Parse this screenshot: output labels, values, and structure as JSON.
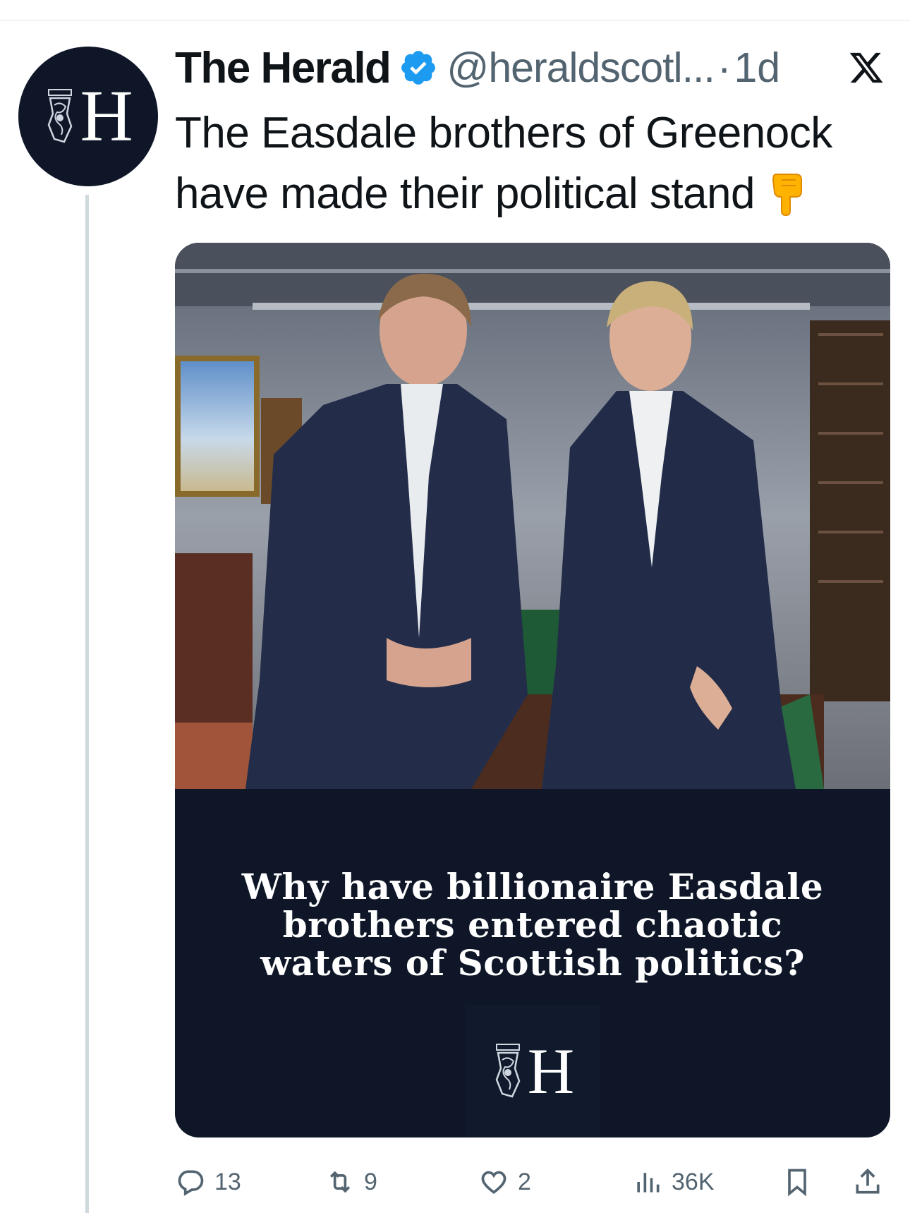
{
  "tweet": {
    "display_name": "The Herald",
    "handle": "@heraldscotl...",
    "separator": "·",
    "time": "1d",
    "text_line_1": "The Easdale brothers of Greenock",
    "text_line_2": "have made their political stand",
    "avatar_letter": "H",
    "verified": true
  },
  "media": {
    "headline_line_1": "Why have billionaire Easdale",
    "headline_line_2": "brothers entered chaotic",
    "headline_line_3": "waters of Scottish politics?",
    "logo_letter": "H",
    "panel_color": "#0e1628"
  },
  "actions": {
    "replies": "13",
    "reposts": "9",
    "likes": "2",
    "views": "36K"
  },
  "colors": {
    "text": "#0f1419",
    "muted": "#536471",
    "verified_blue": "#1d9bf0",
    "brand_navy": "#0e1628"
  },
  "icons": [
    "x-logo-icon",
    "verified-badge-icon",
    "pointing-down-emoji-icon",
    "reply-icon",
    "retweet-icon",
    "like-icon",
    "views-icon",
    "bookmark-icon",
    "share-icon"
  ]
}
